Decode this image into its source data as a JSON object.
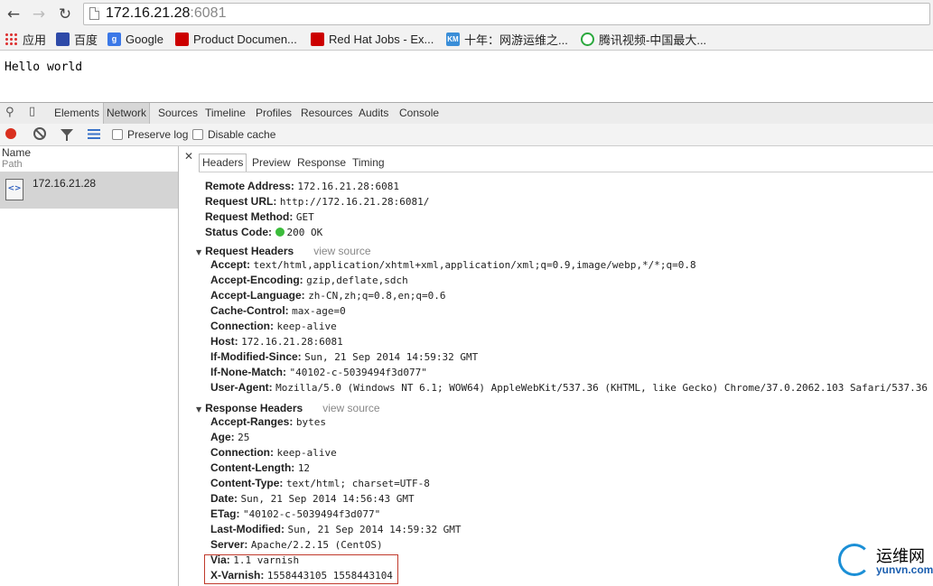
{
  "browser": {
    "url_host": "172.16.21.28",
    "url_port": ":6081",
    "back_glyph": "←",
    "forward_glyph": "→",
    "reload_glyph": "↻",
    "bookmarks": [
      {
        "label": "应用",
        "icon": "apps-icon"
      },
      {
        "label": "百度",
        "icon": "baidu-paw-icon"
      },
      {
        "label": "Google",
        "icon": "google-icon"
      },
      {
        "label": "Product Documen...",
        "icon": "redhat-icon"
      },
      {
        "label": "Red Hat Jobs - Ex...",
        "icon": "redhat-icon"
      },
      {
        "label": "十年：网游运维之...",
        "icon": "km-icon"
      },
      {
        "label": "腾讯视频-中国最大...",
        "icon": "tencent-video-icon"
      }
    ]
  },
  "page": {
    "body_text": "Hello world"
  },
  "devtools": {
    "tabs": [
      "Elements",
      "Network",
      "Sources",
      "Timeline",
      "Profiles",
      "Resources",
      "Audits",
      "Console"
    ],
    "active_tab": "Network",
    "preserve_log": "Preserve log",
    "disable_cache": "Disable cache",
    "list": {
      "col_name": "Name",
      "col_path": "Path",
      "request": "172.16.21.28"
    },
    "detail_tabs": [
      "Headers",
      "Preview",
      "Response",
      "Timing"
    ],
    "general": [
      {
        "key": "Remote Address:",
        "value": "172.16.21.28:6081"
      },
      {
        "key": "Request URL:",
        "value": "http://172.16.21.28:6081/"
      },
      {
        "key": "Request Method:",
        "value": "GET"
      },
      {
        "key": "Status Code:",
        "value": "200 OK"
      }
    ],
    "status_color": "#3cbc3c",
    "request_headers_title": "Request Headers",
    "response_headers_title": "Response Headers",
    "view_source": "view source",
    "request_headers": [
      {
        "key": "Accept:",
        "value": "text/html,application/xhtml+xml,application/xml;q=0.9,image/webp,*/*;q=0.8"
      },
      {
        "key": "Accept-Encoding:",
        "value": "gzip,deflate,sdch"
      },
      {
        "key": "Accept-Language:",
        "value": "zh-CN,zh;q=0.8,en;q=0.6"
      },
      {
        "key": "Cache-Control:",
        "value": "max-age=0"
      },
      {
        "key": "Connection:",
        "value": "keep-alive"
      },
      {
        "key": "Host:",
        "value": "172.16.21.28:6081"
      },
      {
        "key": "If-Modified-Since:",
        "value": "Sun, 21 Sep 2014 14:59:32 GMT"
      },
      {
        "key": "If-None-Match:",
        "value": "\"40102-c-5039494f3d077\""
      },
      {
        "key": "User-Agent:",
        "value": "Mozilla/5.0 (Windows NT 6.1; WOW64) AppleWebKit/537.36 (KHTML, like Gecko) Chrome/37.0.2062.103 Safari/537.36"
      }
    ],
    "response_headers": [
      {
        "key": "Accept-Ranges:",
        "value": "bytes"
      },
      {
        "key": "Age:",
        "value": "25"
      },
      {
        "key": "Connection:",
        "value": "keep-alive"
      },
      {
        "key": "Content-Length:",
        "value": "12"
      },
      {
        "key": "Content-Type:",
        "value": "text/html; charset=UTF-8"
      },
      {
        "key": "Date:",
        "value": "Sun, 21 Sep 2014 14:56:43 GMT"
      },
      {
        "key": "ETag:",
        "value": "\"40102-c-5039494f3d077\""
      },
      {
        "key": "Last-Modified:",
        "value": "Sun, 21 Sep 2014 14:59:32 GMT"
      },
      {
        "key": "Server:",
        "value": "Apache/2.2.15 (CentOS)"
      },
      {
        "key": "Via:",
        "value": "1.1 varnish"
      },
      {
        "key": "X-Varnish:",
        "value": "1558443105 1558443104"
      }
    ],
    "highlight_color": "#c0392b"
  },
  "watermark": {
    "line1": "运维网",
    "line2": "yunvn.com"
  }
}
